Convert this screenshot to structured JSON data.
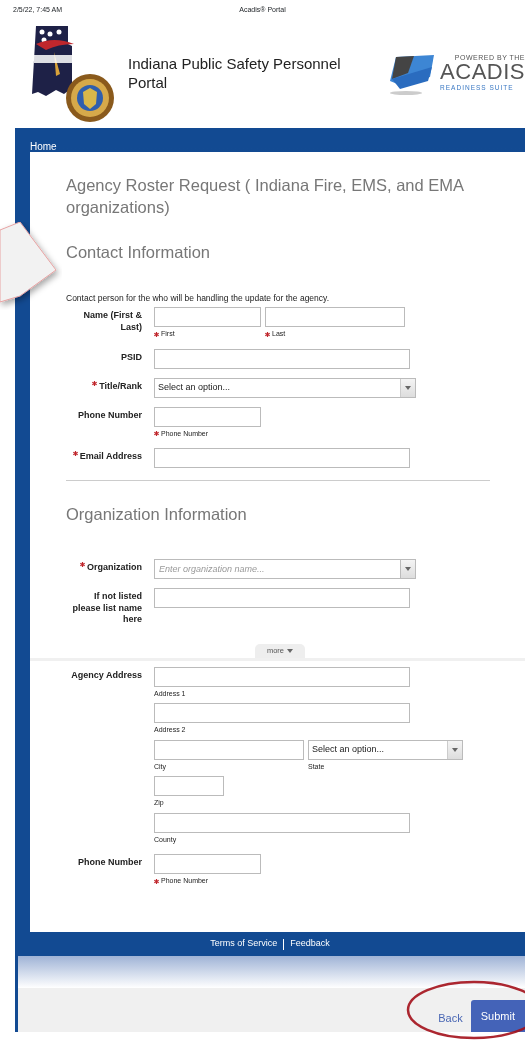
{
  "status_bar": {
    "time": "2/5/22, 7:45 AM",
    "page_title": "Acadis® Portal"
  },
  "header": {
    "title": "Indiana Public Safety Personnel Portal",
    "brand": {
      "tagline": "POWERED BY THE",
      "name": "ACADIS",
      "subtitle": "READINESS SUITE"
    }
  },
  "nav": {
    "breadcrumb": "Home"
  },
  "form": {
    "title": "Agency Roster Request ( Indiana Fire, EMS, and EMA organizations)",
    "sections": [
      {
        "heading": "Contact Information",
        "description": "Contact person for the who will be handling the update for the agency.",
        "fields": [
          {
            "label": "Name (First & Last)",
            "required": false,
            "lines": [
              [
                {
                  "kind": "text-short",
                  "caption": "First",
                  "caption_required": true
                },
                {
                  "kind": "text-medium",
                  "caption": "Last",
                  "caption_required": true
                }
              ]
            ]
          },
          {
            "label": "PSID",
            "required": false,
            "lines": [
              [
                {
                  "kind": "text-long"
                }
              ]
            ]
          },
          {
            "label": "Title/Rank",
            "required": true,
            "lines": [
              [
                {
                  "kind": "select",
                  "value": "Select an option..."
                }
              ]
            ]
          },
          {
            "label": "Phone Number",
            "required": false,
            "lines": [
              [
                {
                  "kind": "text-short",
                  "caption": "Phone Number",
                  "caption_required": true
                }
              ]
            ]
          },
          {
            "label": "Email Address",
            "required": true,
            "lines": [
              [
                {
                  "kind": "text-long"
                }
              ]
            ]
          }
        ]
      },
      {
        "heading": "Organization Information",
        "fields": [
          {
            "label": "Organization",
            "required": true,
            "lines": [
              [
                {
                  "kind": "combo",
                  "placeholder": "Enter organization name..."
                }
              ]
            ]
          },
          {
            "label": "If not listed please list name here",
            "required": false,
            "lines": [
              [
                {
                  "kind": "text-long"
                }
              ]
            ]
          }
        ],
        "more": "more"
      },
      {
        "fields": [
          {
            "label": "Agency Address",
            "required": false,
            "lines": [
              [
                {
                  "kind": "text-long",
                  "caption": "Address 1",
                  "caption_required": false
                }
              ],
              [
                {
                  "kind": "text-long",
                  "caption": "Address 2",
                  "caption_required": false
                }
              ],
              [
                {
                  "kind": "text-city",
                  "caption": "City",
                  "caption_required": false
                },
                {
                  "kind": "select-small",
                  "value": "Select an option...",
                  "caption": "State",
                  "caption_required": false
                }
              ],
              [
                {
                  "kind": "text-tiny",
                  "caption": "Zip",
                  "caption_required": false
                }
              ],
              [
                {
                  "kind": "text-long",
                  "caption": "County",
                  "caption_required": false
                }
              ]
            ]
          },
          {
            "label": "Phone Number",
            "required": false,
            "lines": [
              [
                {
                  "kind": "text-short",
                  "caption": "Phone Number",
                  "caption_required": true
                }
              ]
            ]
          }
        ]
      }
    ]
  },
  "footer": {
    "links": [
      "Terms of Service",
      "Feedback"
    ]
  },
  "actions": [
    {
      "kind": "link",
      "label": "Back"
    },
    {
      "kind": "primary",
      "label": "Submit"
    }
  ]
}
